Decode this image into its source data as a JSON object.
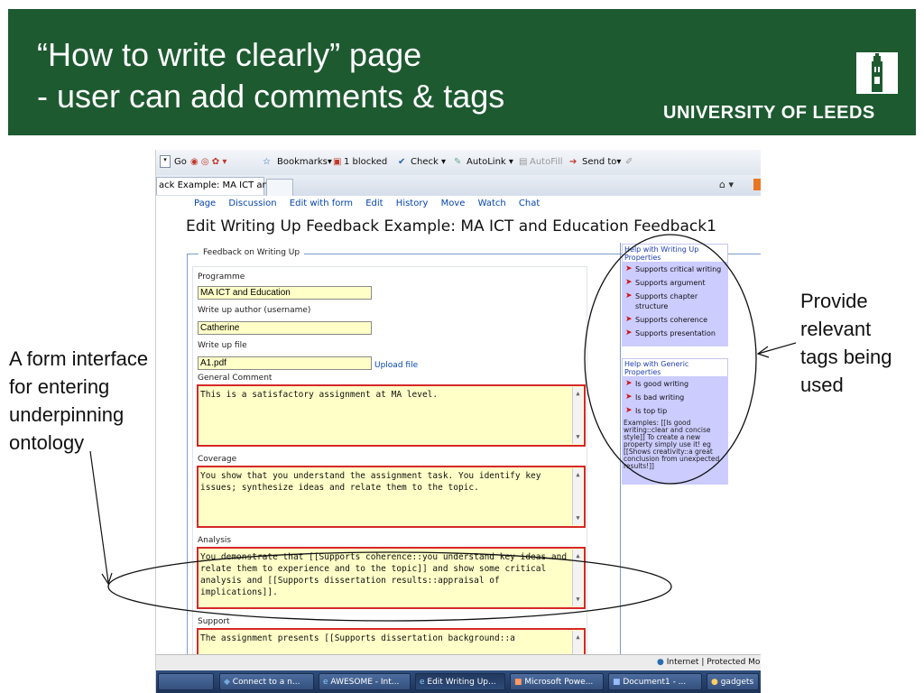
{
  "slide": {
    "title_line1": "“How to write clearly” page",
    "title_line2": "- user can add comments & tags",
    "logo_text": "UNIVERSITY OF LEEDS",
    "colors": {
      "banner": "#1e5a30",
      "title_text": "#ffffff"
    }
  },
  "annotations": {
    "left": [
      "A form interface",
      "for entering",
      "underpinning",
      "ontology"
    ],
    "right": [
      "Provide",
      "relevant",
      "tags being",
      "used"
    ]
  },
  "browser": {
    "toolbar": {
      "go": "Go",
      "bookmarks": "Bookmarks▾",
      "blocked": "1 blocked",
      "check": "Check ▾",
      "autolink": "AutoLink ▾",
      "autofill": "AutoFill",
      "sendto": "Send to▾"
    },
    "tab_label": "ack Example: MA ICT and E...",
    "status_zone": "Internet | Protected Mo",
    "taskbar": [
      {
        "label": "Connect to a n..."
      },
      {
        "label": "AWESOME - Int..."
      },
      {
        "label": "Edit Writing Up..."
      },
      {
        "label": "Microsoft Powe..."
      },
      {
        "label": "Document1 - ..."
      },
      {
        "label": "gadgets"
      }
    ]
  },
  "wiki": {
    "tabs": [
      "Page",
      "Discussion",
      "Edit with form",
      "Edit",
      "History",
      "Move",
      "Watch",
      "Chat"
    ],
    "page_title": "Edit Writing Up Feedback Example: MA ICT and Education Feedback1",
    "fieldset_legend": "Feedback on Writing Up",
    "fields": {
      "programme_label": "Programme",
      "programme_value": "MA ICT and Education",
      "author_label": "Write up author (username)",
      "author_value": "Catherine",
      "file_label": "Write up file",
      "file_value": "A1.pdf",
      "upload_link": "Upload file",
      "general_label": "General Comment",
      "general_value": "This is a satisfactory assignment at MA level.",
      "coverage_label": "Coverage",
      "coverage_value": "You show that you understand the assignment task. You identify key issues; synthesize ideas and relate them to the topic.",
      "analysis_label": "Analysis",
      "analysis_value": "You demonstrate that [[Supports coherence::you understand key ideas and relate them to experience and to the topic]] and show some critical analysis and [[Supports dissertation results::appraisal of implications]].",
      "support_label": "Support",
      "support_value": "The assignment presents [[Supports dissertation background::a"
    },
    "help": {
      "writing_heading": "Help with Writing Up Properties",
      "writing_items": [
        "Supports critical writing",
        "Supports argument",
        "Supports chapter structure",
        "Supports coherence",
        "Supports presentation"
      ],
      "generic_heading": "Help with Generic Properties",
      "generic_items": [
        "Is good writing",
        "Is bad writing",
        "Is top tip"
      ],
      "examples": "Examples: [[Is good writing::clear and concise style]] To create a new property simply use it! eg [[Shows creativity::a great conclusion from unexpected results!]]"
    }
  }
}
